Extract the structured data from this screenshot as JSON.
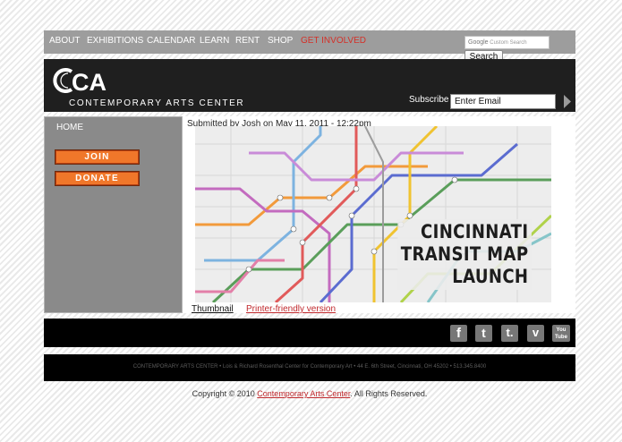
{
  "nav": {
    "items": [
      {
        "label": "About",
        "color": "#ffffff"
      },
      {
        "label": "Exhibitions",
        "color": "#ffffff"
      },
      {
        "label": "Calendar",
        "color": "#ffffff"
      },
      {
        "label": "Learn",
        "color": "#ffffff"
      },
      {
        "label": "Rent",
        "color": "#ffffff"
      },
      {
        "label": "Shop",
        "color": "#ffffff"
      },
      {
        "label": "Get Involved",
        "color": "#d33129"
      }
    ],
    "search_placeholder_brand": "Google",
    "search_placeholder_text": "Custom Search",
    "search_button": "Search"
  },
  "header": {
    "logo_text": "CAC",
    "logo_tagline": "CONTEMPORARY ARTS CENTER",
    "subscribe_label": "Subscribe",
    "subscribe_value": "Enter Email",
    "go_icon": "arrow-right-icon"
  },
  "sidebar": {
    "home": "HOME",
    "join_label": "JOIN",
    "donate_label": "DONATE",
    "button_color": "#f0772a"
  },
  "content": {
    "submitted": "Submitted by Josh on May 11, 2011 - 12:22pm",
    "map_title_lines": [
      "CINCINNATI",
      "TRANSIT MAP",
      "LAUNCH"
    ],
    "thumbnail_link": "Thumbnail",
    "printer_link": "Printer-friendly version"
  },
  "social": {
    "icons": [
      {
        "name": "facebook-icon",
        "glyph": "f"
      },
      {
        "name": "twitter-icon",
        "glyph": "t"
      },
      {
        "name": "tumblr-icon",
        "glyph": "t."
      },
      {
        "name": "vimeo-icon",
        "glyph": "v"
      },
      {
        "name": "youtube-icon",
        "glyph": "You Tube"
      }
    ]
  },
  "footer": {
    "address": "CONTEMPORARY ARTS CENTER • Lois & Richard Rosenthal Center for Contemporary Art • 44 E. 6th Street, Cincinnati, OH 45202 • 513.345.8400",
    "copyright_prefix": "Copyright © 2010 ",
    "copyright_link": "Contemporary Arts Center",
    "copyright_suffix": ". All Rights Reserved."
  }
}
